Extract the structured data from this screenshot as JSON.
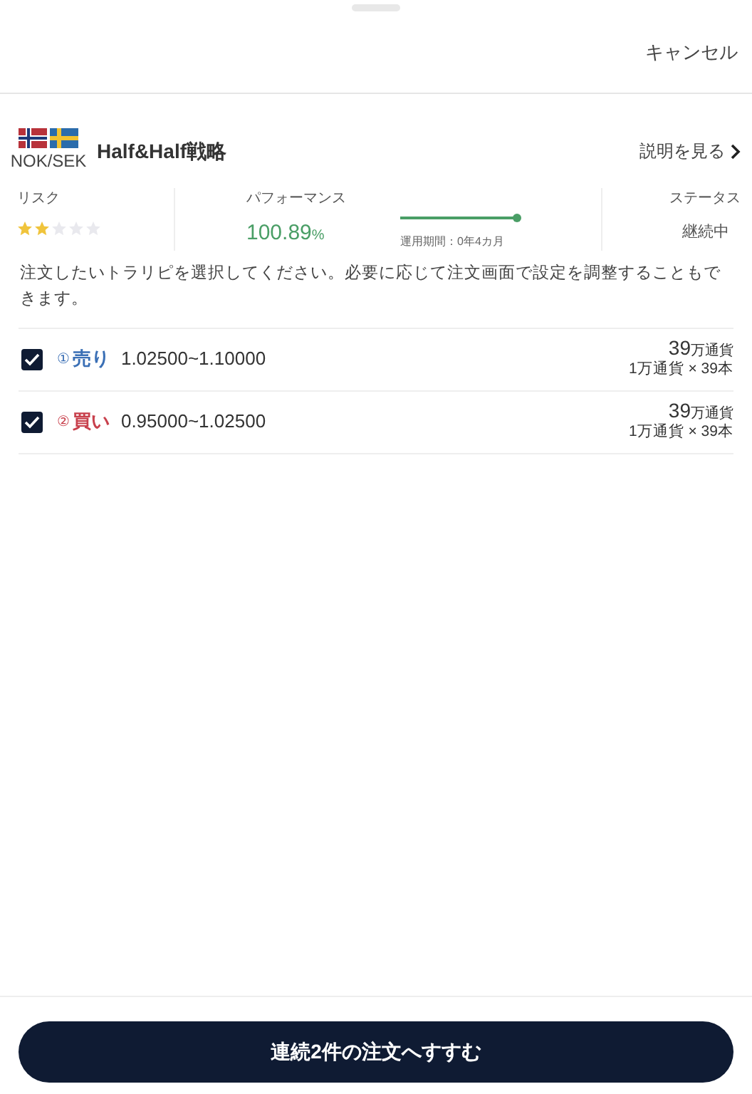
{
  "header": {
    "cancel": "キャンセル"
  },
  "strategy": {
    "pair": "NOK/SEK",
    "name": "Half&Half戦略",
    "detail_link": "説明を見る"
  },
  "stats": {
    "risk_label": "リスク",
    "risk": {
      "stars": 2
    },
    "performance_label": "パフォーマンス",
    "performance_value": "100.89",
    "performance_unit": "%",
    "period": {
      "level": 1,
      "text": "運用期間：0年4カ月"
    },
    "status_label": "ステータス",
    "status": "継続中"
  },
  "instruction": "注文したいトラリピを選択してください。必要に応じて注文画面で設定を調整することもできます。",
  "orders": [
    {
      "number": "①",
      "kind": "sell",
      "side": "売り",
      "range": "1.02500~1.10000",
      "amount": "39",
      "amount_unit": "万通貨",
      "breakdown": "1万通貨 × 39本",
      "checked": true
    },
    {
      "number": "②",
      "kind": "buy",
      "side": "買い",
      "range": "0.95000~1.02500",
      "amount": "39",
      "amount_unit": "万通貨",
      "breakdown": "1万通貨 × 39本",
      "checked": true
    }
  ],
  "submit": "連続2件の注文へすすむ"
}
